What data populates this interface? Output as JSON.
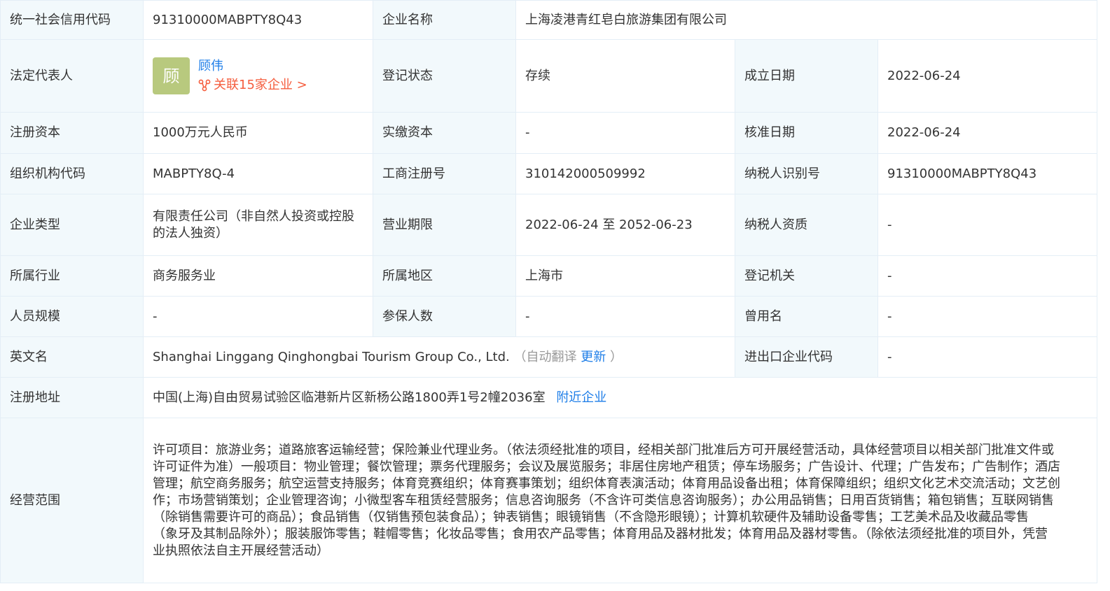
{
  "rows": {
    "credit_code": {
      "label": "统一社会信用代码",
      "value": "91310000MABPTY8Q43"
    },
    "company_name": {
      "label": "企业名称",
      "value": "上海凌港青红皂白旅游集团有限公司"
    },
    "legal_rep": {
      "label": "法定代表人",
      "avatar_char": "顾",
      "name": "顾伟",
      "related": "关联15家企业 >"
    },
    "reg_status": {
      "label": "登记状态",
      "value": "存续"
    },
    "founded": {
      "label": "成立日期",
      "value": "2022-06-24"
    },
    "reg_capital": {
      "label": "注册资本",
      "value": "1000万元人民币"
    },
    "paid_capital": {
      "label": "实缴资本",
      "value": "-"
    },
    "approval_date": {
      "label": "核准日期",
      "value": "2022-06-24"
    },
    "org_code": {
      "label": "组织机构代码",
      "value": "MABPTY8Q-4"
    },
    "biz_reg_no": {
      "label": "工商注册号",
      "value": "310142000509992"
    },
    "taxpayer_id": {
      "label": "纳税人识别号",
      "value": "91310000MABPTY8Q43"
    },
    "company_type": {
      "label": "企业类型",
      "value": "有限责任公司（非自然人投资或控股的法人独资）"
    },
    "biz_term": {
      "label": "营业期限",
      "value": "2022-06-24 至 2052-06-23"
    },
    "tax_qual": {
      "label": "纳税人资质",
      "value": "-"
    },
    "industry": {
      "label": "所属行业",
      "value": "商务服务业"
    },
    "region": {
      "label": "所属地区",
      "value": "上海市"
    },
    "reg_authority": {
      "label": "登记机关",
      "value": "-"
    },
    "staff_size": {
      "label": "人员规模",
      "value": "-"
    },
    "insured": {
      "label": "参保人数",
      "value": "-"
    },
    "former_name": {
      "label": "曾用名",
      "value": "-"
    },
    "english_name": {
      "label": "英文名",
      "value": "Shanghai Linggang Qinghongbai Tourism Group Co., Ltd.",
      "note_open": "（自动翻译",
      "update_link": "更新",
      "note_close": "）"
    },
    "ie_code": {
      "label": "进出口企业代码",
      "value": "-"
    },
    "address": {
      "label": "注册地址",
      "value": "中国(上海)自由贸易试验区临港新片区新杨公路1800弄1号2幢2036室",
      "nearby_link": "附近企业"
    },
    "scope": {
      "label": "经营范围",
      "lines": [
        "许可项目：旅游业务；道路旅客运输经营；保险兼业代理业务。（依法须经批准的项目，经相关部门批准后方可开展经营活动，具体经营项目以相关部门批准文件或",
        "许可证件为准）一般项目：物业管理；餐饮管理；票务代理服务；会议及展览服务；非居住房地产租赁；停车场服务；广告设计、代理；广告发布；广告制作；酒店",
        "管理；航空商务服务；航空运营支持服务；体育竞赛组织；体育赛事策划；组织体育表演活动；体育用品设备出租；体育保障组织；组织文化艺术交流活动；文艺创",
        "作；市场营销策划；企业管理咨询；小微型客车租赁经营服务；信息咨询服务（不含许可类信息咨询服务）；办公用品销售；日用百货销售；箱包销售；互联网销售",
        "（除销售需要许可的商品）；食品销售（仅销售预包装食品）；钟表销售；眼镜销售（不含隐形眼镜）；计算机软硬件及辅助设备零售；工艺美术品及收藏品零售",
        "（象牙及其制品除外）；服装服饰零售；鞋帽零售；化妆品零售；食用农产品零售；体育用品及器材批发；体育用品及器材零售。（除依法须经批准的项目外，凭营",
        "业执照依法自主开展经营活动）"
      ]
    }
  },
  "colors": {
    "label_bg": "#f2f9fc",
    "border": "#e4eef6",
    "link": "#1e7ee8",
    "related": "#f55d3e",
    "avatar_bg": "#b8c97e"
  }
}
